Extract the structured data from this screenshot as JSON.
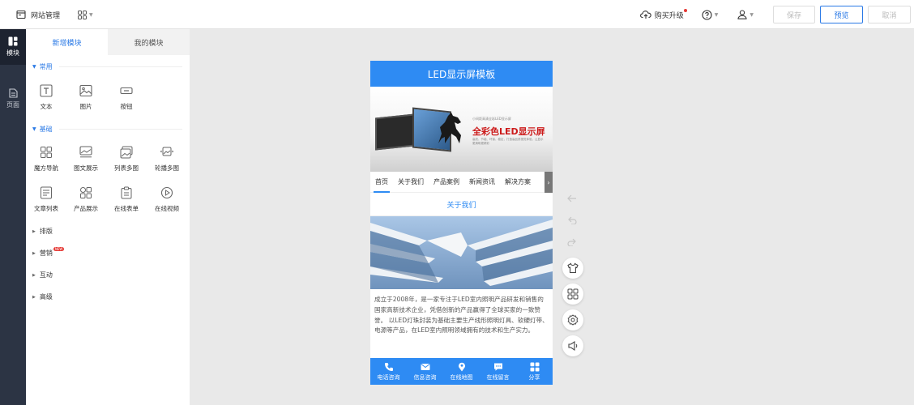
{
  "topbar": {
    "title": "网站管理",
    "upgrade_label": "购买升级",
    "save_label": "保存",
    "preview_label": "预览",
    "cancel_label": "取消"
  },
  "rail": {
    "items": [
      {
        "label": "模块",
        "icon": "module-icon"
      },
      {
        "label": "页面",
        "icon": "page-icon"
      }
    ]
  },
  "panel": {
    "tabs": [
      "新增模块",
      "我的模块"
    ],
    "sections": {
      "common": {
        "title": "常用",
        "items": [
          "文本",
          "图片",
          "按钮"
        ]
      },
      "basic": {
        "title": "基础",
        "items": [
          "魔方导航",
          "图文展示",
          "列表多图",
          "轮播多图",
          "文章列表",
          "产品展示",
          "在线表单",
          "在线视频"
        ]
      }
    },
    "categories": [
      "排版",
      "营销",
      "互动",
      "高级"
    ],
    "new_badge": "NEW"
  },
  "phone": {
    "header_title": "LED显示屏模板",
    "banner": {
      "small_text": "小间距高清全彩LED显示屏",
      "title": "全彩色LED显示屏",
      "desc": "高亮、节能、环保、稳定，打造高品质视觉体验，让显示更清晰更精彩"
    },
    "nav": [
      "首页",
      "关于我们",
      "产品案例",
      "新闻资讯",
      "解决方案"
    ],
    "about_title": "关于我们",
    "about_text": "成立于2008年，是一家专注于LED室内照明产品研发和销售的国家高新技术企业，凭借创新的产品赢得了全球买家的一致赞誉。 以LED灯珠封装为基础主要生产线形照明灯具、软硬灯带、电源等产品，在LED室内照明领域拥有的技术和生产实力。",
    "footer": [
      {
        "label": "电话咨询",
        "icon": "phone-icon"
      },
      {
        "label": "信息咨询",
        "icon": "mail-icon"
      },
      {
        "label": "在线地图",
        "icon": "map-pin-icon"
      },
      {
        "label": "在线留言",
        "icon": "message-icon"
      },
      {
        "label": "分享",
        "icon": "share-icon"
      }
    ]
  },
  "colors": {
    "accent": "#2b7ae6",
    "phone_primary": "#2e8bf3",
    "rail_bg": "#2c3444",
    "banner_title": "#cc1a1a"
  }
}
